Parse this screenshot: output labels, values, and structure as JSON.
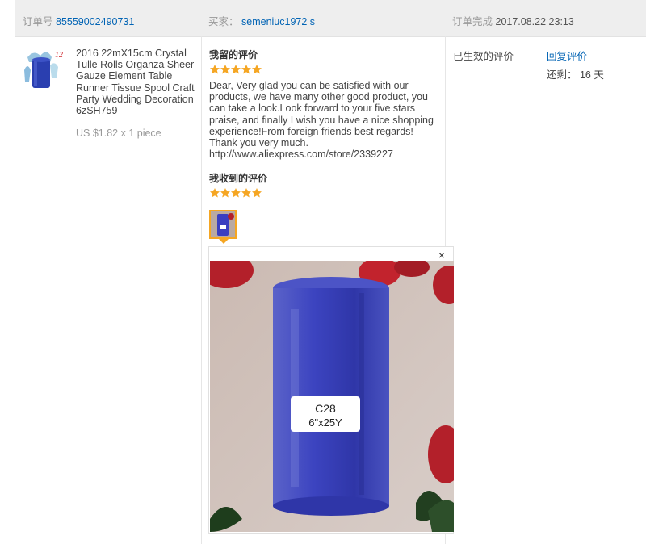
{
  "order": {
    "number_label": "订单号",
    "number_value": "85559002490731",
    "buyer_label": "买家：",
    "buyer_value": "semeniuc1972 s",
    "completed_label": "订单完成",
    "completed_value": "2017.08.22 23:13"
  },
  "product": {
    "thumb_badge": "12",
    "title": "2016 22mX15cm Crystal Tulle Rolls Organza Sheer Gauze Element Table Runner Tissue Spool Craft Party Wedding Decoration 6zSH759",
    "price": "US $1.82 x 1 piece",
    "thumb_icon": "tulle-roll-product-image"
  },
  "my_feedback": {
    "title": "我留的评价",
    "rating": 5,
    "text": "Dear, Very glad you can be satisfied with our products, we have many other good product, you can take a look.Look forward to your five stars praise, and finally I wish you have a nice shopping experience!From foreign friends best regards! Thank you very much.\nhttp://www.aliexpress.com/store/2339227"
  },
  "received_feedback": {
    "title": "我收到的评价",
    "rating": 5,
    "photo_label_line1": "C28",
    "photo_label_line2": "6\"x25Y"
  },
  "popup": {
    "close_glyph": "×"
  },
  "status": {
    "label": "已生效的评价",
    "reply_link": "回复评价",
    "remaining": "还剩： 16 天"
  },
  "colors": {
    "link": "#0063b4",
    "star": "#f5a623",
    "header_bg": "#eeeeee",
    "tulle_blue": "#3a3ec0"
  }
}
